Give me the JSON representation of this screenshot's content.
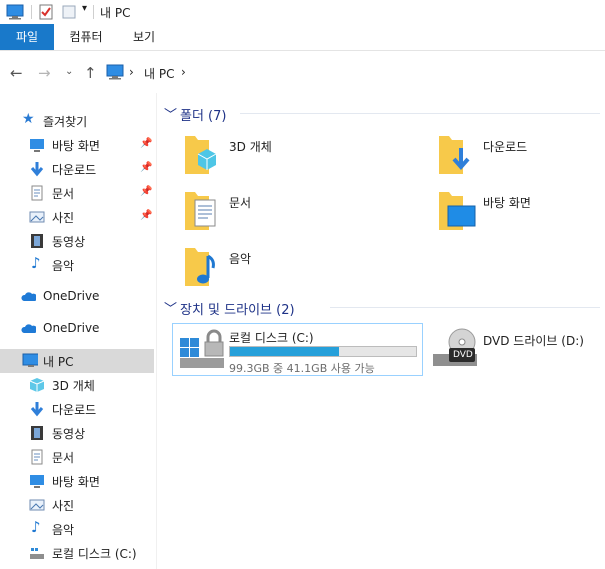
{
  "window": {
    "title": "내 PC"
  },
  "ribbon": {
    "tabs": [
      "파일",
      "컴퓨터",
      "보기"
    ]
  },
  "address": {
    "crumbs": [
      "내 PC"
    ]
  },
  "sidebar": {
    "quick_access": "즐겨찾기",
    "quick_items": [
      "바탕 화면",
      "다운로드",
      "문서",
      "사진",
      "동영상",
      "음악"
    ],
    "onedrive_1": "OneDrive",
    "onedrive_2": "OneDrive",
    "this_pc": "내 PC",
    "pc_items": [
      "3D 개체",
      "다운로드",
      "동영상",
      "문서",
      "바탕 화면",
      "사진",
      "음악",
      "로컬 디스크 (C:)"
    ]
  },
  "content": {
    "folders_header": "폴더 (7)",
    "folders": [
      "3D 개체",
      "다운로드",
      "문서",
      "바탕 화면",
      "음악"
    ],
    "devices_header": "장치 및 드라이브 (2)",
    "local_disk": {
      "name": "로컬 디스크 (C:)",
      "used_fraction": 0.586,
      "space_text": "99.3GB 중 41.1GB 사용 가능"
    },
    "dvd": {
      "name": "DVD 드라이브 (D:)",
      "badge": "DVD"
    }
  },
  "colors": {
    "accent": "#1979ca",
    "folder": "#ffd56a",
    "selection": "#d9d9d9",
    "progress": "#26a0da"
  }
}
